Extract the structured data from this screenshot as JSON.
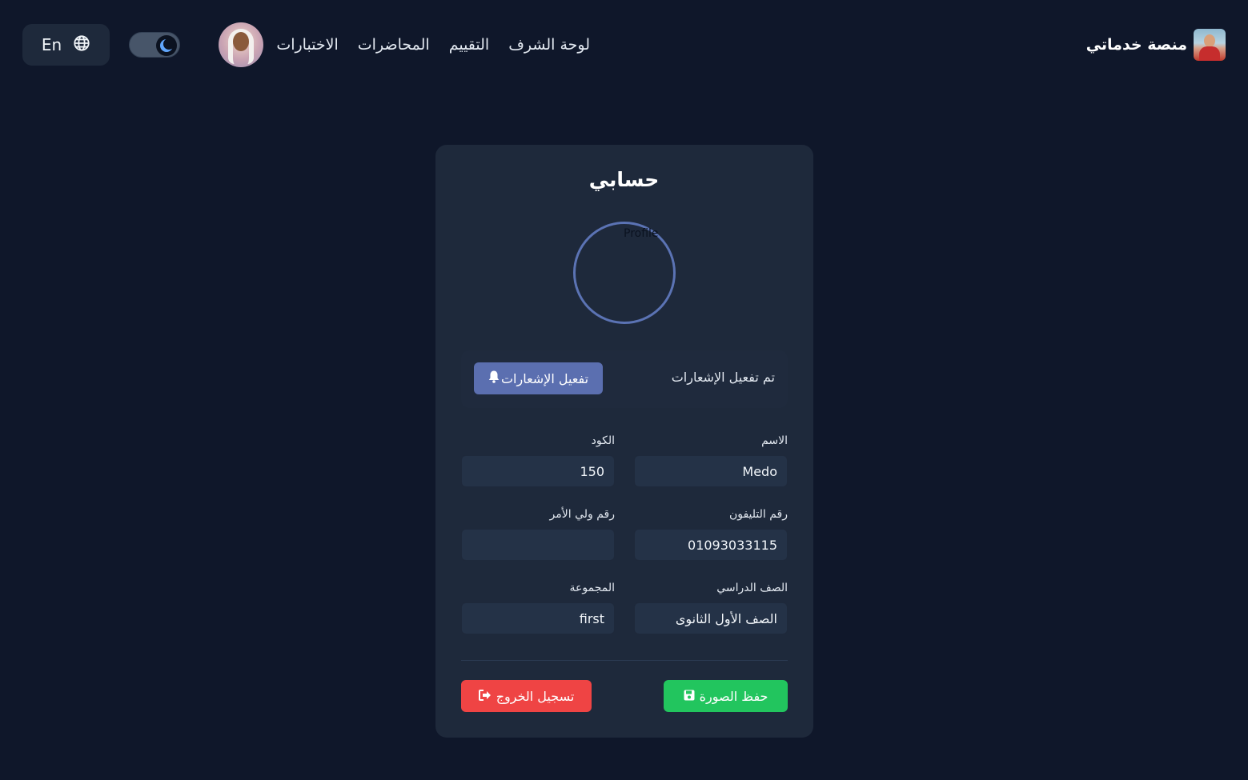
{
  "header": {
    "brand_name": "منصة خدماتي",
    "nav": [
      {
        "label": "الاختبارات"
      },
      {
        "label": "المحاضرات"
      },
      {
        "label": "التقييم"
      },
      {
        "label": "لوحة الشرف"
      }
    ],
    "theme_toggle": {
      "mode": "dark",
      "icon": "moon-icon"
    },
    "language_button": {
      "label": "En",
      "icon": "globe-icon"
    }
  },
  "profile": {
    "title": "حسابي",
    "image_alt": "Profile",
    "notifications": {
      "status": "تم تفعيل الإشعارات",
      "button_label": "تفعيل الإشعارات",
      "button_icon": "bell-icon"
    },
    "fields": {
      "name": {
        "label": "الاسم",
        "value": "Medo"
      },
      "code": {
        "label": "الكود",
        "value": "150"
      },
      "phone": {
        "label": "رقم التليفون",
        "value": "01093033115"
      },
      "parent_phone": {
        "label": "رقم ولي الأمر",
        "value": ""
      },
      "grade": {
        "label": "الصف الدراسي",
        "value": "الصف الأول الثانوى"
      },
      "group": {
        "label": "المجموعة",
        "value": "first"
      }
    },
    "actions": {
      "save_label": "حفظ الصورة",
      "save_icon": "floppy-disk-icon",
      "logout_label": "تسجيل الخروج",
      "logout_icon": "sign-out-icon"
    }
  },
  "colors": {
    "background": "#0f172a",
    "card": "#1e293b",
    "primary": "#5b6fb0",
    "success": "#22c55e",
    "danger": "#ef4444"
  }
}
